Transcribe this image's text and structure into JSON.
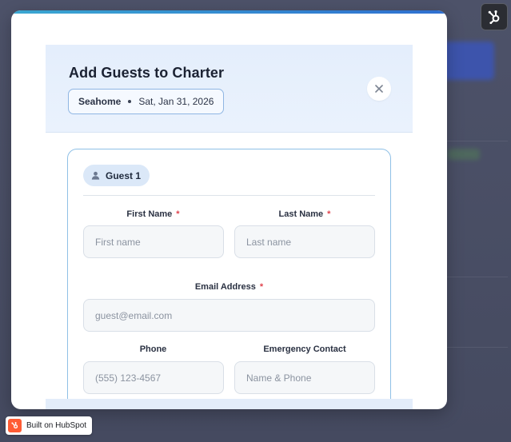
{
  "modal": {
    "title": "Add Guests to Charter",
    "charter": {
      "location": "Seahome",
      "date": "Sat, Jan 31, 2026"
    }
  },
  "guest": {
    "label": "Guest 1",
    "fields": {
      "first_name": {
        "label": "First Name",
        "required": "*",
        "placeholder": "First name"
      },
      "last_name": {
        "label": "Last Name",
        "required": "*",
        "placeholder": "Last name"
      },
      "email": {
        "label": "Email Address",
        "required": "*",
        "placeholder": "guest@email.com"
      },
      "phone": {
        "label": "Phone",
        "placeholder": "(555) 123-4567"
      },
      "emergency": {
        "label": "Emergency Contact",
        "placeholder": "Name & Phone"
      }
    }
  },
  "badge": {
    "text": "Built on HubSpot"
  },
  "icons": {
    "close": "close-icon",
    "guest": "person-icon",
    "hubspot": "hubspot-sprocket-icon"
  },
  "colors": {
    "accent": "#2f6fd0",
    "required": "#e0434d",
    "hubspot": "#ff5c35"
  }
}
